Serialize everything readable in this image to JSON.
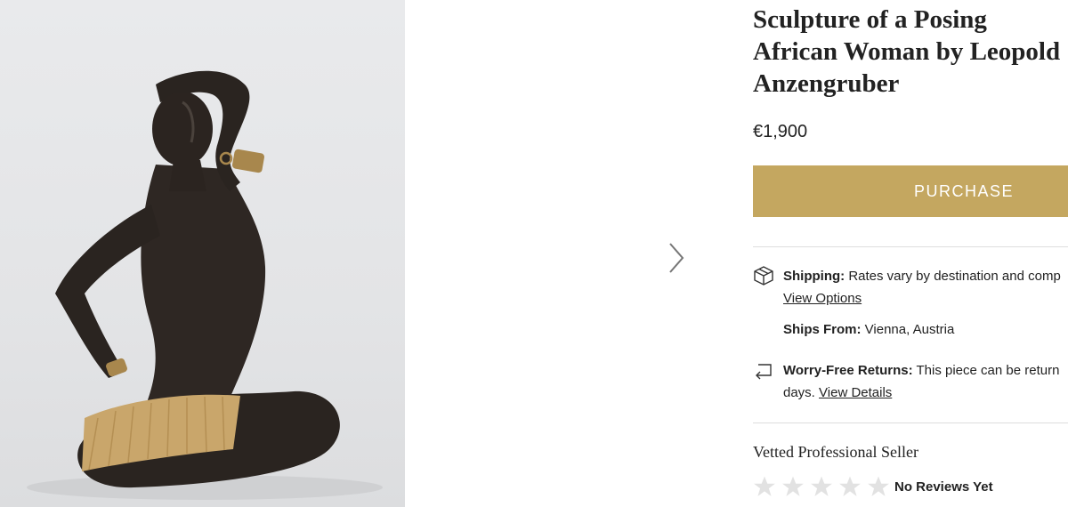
{
  "product": {
    "title": "Sculpture of a Posing African Woman by Leopold Anzengruber",
    "price": "€1,900",
    "purchase_label": "PURCHASE"
  },
  "gallery": {
    "image_alt": "Black ceramic sculpture of a kneeling woman with a raffia skirt",
    "next_icon": "chevron-right-icon"
  },
  "shipping": {
    "icon": "package-icon",
    "label": "Shipping:",
    "text": " Rates vary by destination and comp",
    "link": "View Options"
  },
  "ships_from": {
    "label": "Ships From:",
    "value": " Vienna, Austria"
  },
  "returns": {
    "icon": "return-arrow-icon",
    "label": "Worry-Free Returns:",
    "text": " This piece can be return",
    "text2": "days. ",
    "link": "View Details"
  },
  "seller": {
    "label": "Vetted Professional Seller",
    "rating": 0,
    "max_rating": 5,
    "reviews_text": "No Reviews Yet"
  },
  "colors": {
    "accent": "#c4a760",
    "star_empty": "#e2e2e2"
  }
}
